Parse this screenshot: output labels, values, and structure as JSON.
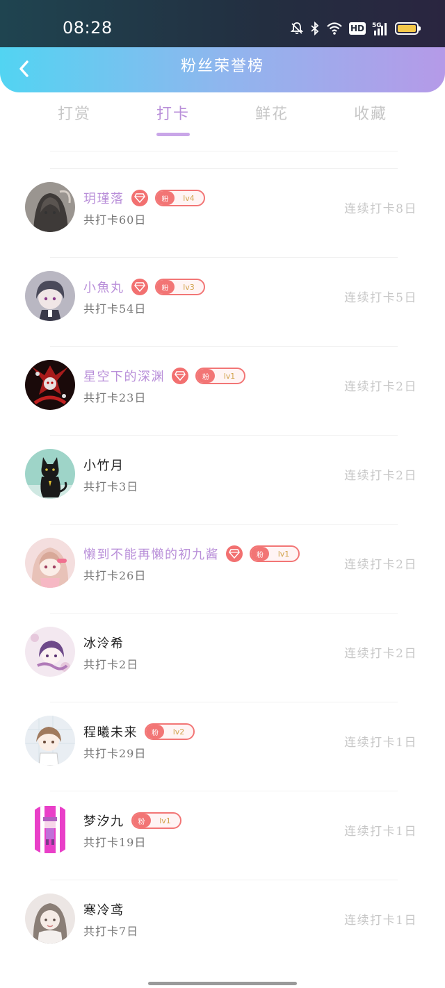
{
  "status_bar": {
    "time": "08:28",
    "hd_label": "HD",
    "network_label": "5G"
  },
  "header": {
    "title": "粉丝荣誉榜"
  },
  "tabs": [
    {
      "label": "打赏",
      "active": false
    },
    {
      "label": "打卡",
      "active": true
    },
    {
      "label": "鲜花",
      "active": false
    },
    {
      "label": "收藏",
      "active": false
    }
  ],
  "colors": {
    "accent": "#b98fd9",
    "badge_red": "#f27575",
    "muted": "#c7c7c7"
  },
  "fan_badge_label": "粉",
  "fans": [
    {
      "name": "玥瑾落",
      "vip": true,
      "level": "lv4",
      "total": "共打卡60日",
      "streak": "连续打卡8日",
      "avatar": "anime-girl-dark"
    },
    {
      "name": "小魚丸",
      "vip": true,
      "level": "lv3",
      "total": "共打卡54日",
      "streak": "连续打卡5日",
      "avatar": "anime-boy-gray"
    },
    {
      "name": "星空下的深渊",
      "vip": true,
      "level": "lv1",
      "total": "共打卡23日",
      "streak": "连续打卡2日",
      "avatar": "red-demon"
    },
    {
      "name": "小竹月",
      "vip": false,
      "level": "",
      "total": "共打卡3日",
      "streak": "连续打卡2日",
      "avatar": "black-cat"
    },
    {
      "name": "懒到不能再懒的初九酱",
      "vip": true,
      "level": "lv1",
      "total": "共打卡26日",
      "streak": "连续打卡2日",
      "avatar": "pink-anime-girl"
    },
    {
      "name": "冰泠希",
      "vip": false,
      "level": "",
      "total": "共打卡2日",
      "streak": "连续打卡2日",
      "avatar": "purple-anime-girl"
    },
    {
      "name": "程曦未来",
      "vip": false,
      "level": "lv2",
      "total": "共打卡29日",
      "streak": "连续打卡1日",
      "avatar": "chibi-girl"
    },
    {
      "name": "梦汐九",
      "vip": false,
      "level": "lv1",
      "total": "共打卡19日",
      "streak": "连续打卡1日",
      "avatar": "pink-pixel-character"
    },
    {
      "name": "寒冷鸢",
      "vip": false,
      "level": "",
      "total": "共打卡7日",
      "streak": "连续打卡1日",
      "avatar": "pastel-girl"
    }
  ]
}
